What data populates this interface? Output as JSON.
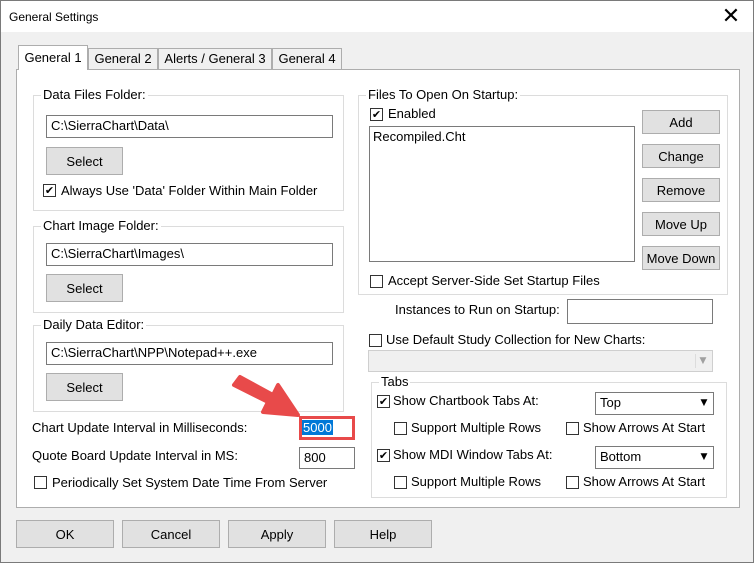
{
  "window": {
    "title": "General Settings",
    "close_glyph": "✕"
  },
  "tabs": [
    {
      "label": "General 1"
    },
    {
      "label": "General 2"
    },
    {
      "label": "Alerts / General 3"
    },
    {
      "label": "General 4"
    }
  ],
  "data_files": {
    "legend": "Data Files Folder:",
    "path": "C:\\SierraChart\\Data\\",
    "select_label": "Select",
    "always_use_label": "Always Use 'Data' Folder Within Main Folder",
    "always_use_checked": true
  },
  "chart_image": {
    "legend": "Chart Image Folder:",
    "path": "C:\\SierraChart\\Images\\",
    "select_label": "Select"
  },
  "daily_editor": {
    "legend": "Daily Data Editor:",
    "path": "C:\\SierraChart\\NPP\\Notepad++.exe",
    "select_label": "Select"
  },
  "intervals": {
    "chart_update_label": "Chart Update Interval in Milliseconds:",
    "chart_update_value": "5000",
    "quote_board_label": "Quote Board Update Interval in MS:",
    "quote_board_value": "800",
    "periodic_label": "Periodically Set System Date Time From Server",
    "periodic_checked": false
  },
  "startup_files": {
    "legend": "Files To Open On Startup:",
    "enabled_label": "Enabled",
    "enabled_checked": true,
    "items": [
      "Recompiled.Cht"
    ],
    "buttons": {
      "add": "Add",
      "change": "Change",
      "remove": "Remove",
      "move_up": "Move Up",
      "move_down": "Move Down"
    },
    "accept_label": "Accept Server-Side Set Startup Files",
    "accept_checked": false
  },
  "instances": {
    "label": "Instances to Run on Startup:",
    "value": ""
  },
  "study_collection": {
    "label": "Use Default Study Collection for New Charts:",
    "checked": false,
    "value": ""
  },
  "tabs_group": {
    "legend": "Tabs",
    "chartbook_label": "Show Chartbook Tabs At:",
    "chartbook_checked": true,
    "chartbook_value": "Top",
    "mdi_label": "Show MDI Window Tabs At:",
    "mdi_checked": true,
    "mdi_value": "Bottom",
    "support_multiple_rows": "Support Multiple Rows",
    "show_arrows_at_start": "Show Arrows At Start"
  },
  "annotation": {
    "arrow_color": "#e84a4a",
    "highlight_color": "#e84a4a"
  },
  "footer": {
    "ok": "OK",
    "cancel": "Cancel",
    "apply": "Apply",
    "help": "Help"
  },
  "icons": {
    "check": "✔",
    "dropdown": "▼"
  }
}
